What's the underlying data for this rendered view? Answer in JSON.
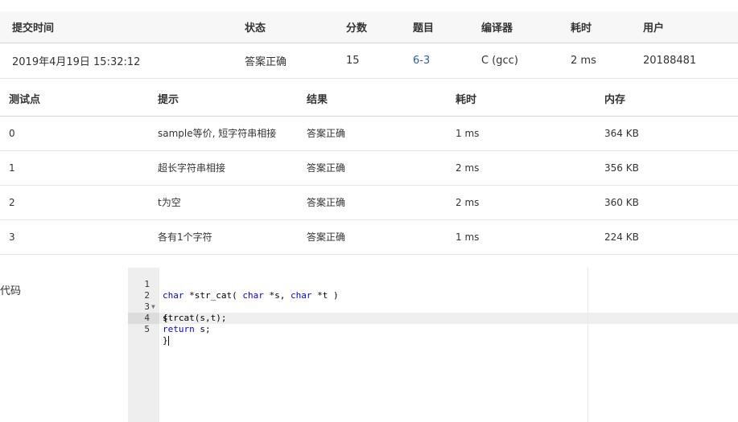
{
  "submission": {
    "headers": [
      "提交时间",
      "状态",
      "分数",
      "题目",
      "编译器",
      "耗时",
      "用户"
    ],
    "row": {
      "time": "2019年4月19日 15:32:12",
      "status": "答案正确",
      "score": "15",
      "problem": "6-3",
      "compiler": "C (gcc)",
      "duration": "2 ms",
      "user": "20188481"
    }
  },
  "cases": {
    "headers": [
      "测试点",
      "提示",
      "结果",
      "耗时",
      "内存"
    ],
    "rows": [
      {
        "id": "0",
        "hint": "sample等价, 短字符串相接",
        "result": "答案正确",
        "time": "1 ms",
        "memory": "364 KB"
      },
      {
        "id": "1",
        "hint": "超长字符串相接",
        "result": "答案正确",
        "time": "2 ms",
        "memory": "356 KB"
      },
      {
        "id": "2",
        "hint": "t为空",
        "result": "答案正确",
        "time": "2 ms",
        "memory": "360 KB"
      },
      {
        "id": "3",
        "hint": "各有1个字符",
        "result": "答案正确",
        "time": "1 ms",
        "memory": "224 KB"
      }
    ]
  },
  "code": {
    "label": "代码",
    "lines": [
      {
        "n": "1",
        "text": "char *str_cat( char *s, char *t )"
      },
      {
        "n": "2",
        "text": "{"
      },
      {
        "n": "3",
        "text": "strcat(s,t);"
      },
      {
        "n": "4",
        "text": "return s;"
      },
      {
        "n": "5",
        "text": "}"
      }
    ]
  },
  "colors": {
    "accepted": "#e74c3c",
    "link": "#2a5db0",
    "header_bg": "#f7f7f7",
    "gutter_bg": "#eeeeee"
  }
}
